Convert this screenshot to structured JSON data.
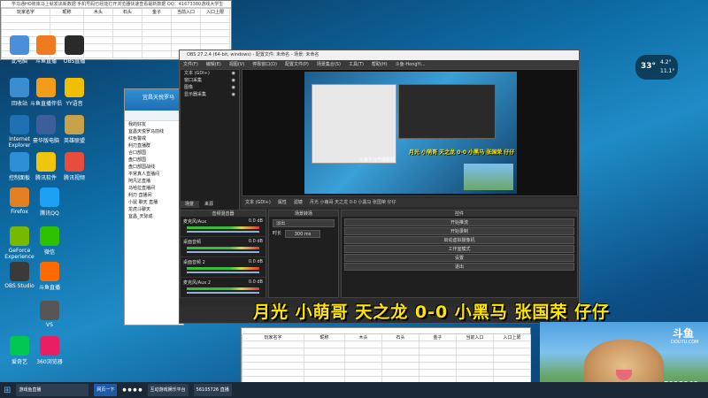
{
  "excel_top": {
    "title": "学马通HO账库马上就发出新数据 手机号码已经能打开浏览器快速查看最新数据 QQ：41673380游戏大学生",
    "headers": [
      "玩家名字",
      "昵称",
      "木头",
      "石头",
      "金子",
      "当前入口",
      "入口上限"
    ]
  },
  "desktop_icons": [
    {
      "label": "此电脑",
      "icon": "pc-icon"
    },
    {
      "label": "斗鱼直播",
      "icon": "douyu-icon"
    },
    {
      "label": "OBS直播",
      "icon": "obs-icon"
    },
    {
      "label": "回收站",
      "icon": "recycle-icon"
    },
    {
      "label": "斗鱼直播伴侣",
      "icon": "box-icon"
    },
    {
      "label": "YY语音",
      "icon": "yy-icon"
    },
    {
      "label": "Internet Explorer",
      "icon": "ie-icon"
    },
    {
      "label": "豪华版电脑",
      "icon": "app-icon"
    },
    {
      "label": "英雄联盟",
      "icon": "game-icon"
    },
    {
      "label": "控制面板",
      "icon": "control-icon"
    },
    {
      "label": "腾讯软件",
      "icon": "qq-app-icon"
    },
    {
      "label": "腾讯视频",
      "icon": "video-icon"
    },
    {
      "label": "Firefox",
      "icon": "firefox-icon"
    },
    {
      "label": "腾讯QQ",
      "icon": "qq-icon"
    },
    {
      "label": "GeForce Experience",
      "icon": "nvidia-icon"
    },
    {
      "label": "微信",
      "icon": "wechat-icon"
    },
    {
      "label": "OBS Studio",
      "icon": "obs-studio-icon"
    },
    {
      "label": "斗鱼直播",
      "icon": "douyu2-icon"
    },
    {
      "label": "VS",
      "icon": "vs-icon"
    },
    {
      "label": "爱奇艺",
      "icon": "iqiyi-icon"
    },
    {
      "label": "360浏览器",
      "icon": "browser360-icon"
    }
  ],
  "chat": {
    "title": "宜昌天悦罗马",
    "rows": [
      "我的好友",
      "宜昌天悦罗马前线",
      "红色警戒",
      "利刃直播群",
      "合口部国",
      "盘口部国",
      "盘口部国战线",
      "平常真人直播间",
      "阿凡达直播",
      "马哈拉直播间",
      "利刃 直播间",
      "小鼠 聊天 直播",
      "龙虎斗聊天",
      "宜昌_天际成"
    ]
  },
  "obs": {
    "title": "OBS 27.2.4 (64-bit, windows) - 配置文件: 未命名 - 场景: 未命名",
    "menu": [
      "文件(F)",
      "编辑(E)",
      "视图(V)",
      "停靠窗口(D)",
      "配置文件(P)",
      "场景集合(S)",
      "工具(T)",
      "帮助(H)",
      "斗鱼-HongYi..."
    ],
    "sources": [
      "文本 (GDI+)",
      "窗口采集",
      "图像",
      "显示器采集"
    ],
    "tabs": [
      "场景",
      "来源"
    ],
    "text_source": "文本 (GDI+)",
    "prop_btns": [
      "属性",
      "滤镜"
    ],
    "text_label": "月光 小萌哥 天之龙 0-0 小黑马 张国荣 仔仔",
    "mixer_label": "音频混音器",
    "mixer": [
      {
        "name": "麦克风/Aux",
        "db": "0.0 dB"
      },
      {
        "name": "桌面音频",
        "db": "0.0 dB"
      },
      {
        "name": "桌面音频 2",
        "db": "0.0 dB"
      },
      {
        "name": "麦克风/Aux 2",
        "db": "0.0 dB"
      }
    ],
    "transition_label": "场景转场",
    "transition_type": "淡出",
    "duration_label": "时长",
    "duration": "300 ms",
    "controls_label": "控件",
    "controls": [
      "开始推流",
      "开始录制",
      "启动虚拟摄像机",
      "工作室模式",
      "设置",
      "退出"
    ],
    "preview_subtitle": "斗鱼平台开播教程",
    "preview_banner": "月光 小萌哥 天之龙 0-0 小黑马 张国荣 仔仔"
  },
  "banner": "月光 小萌哥 天之龙 0-0 小黑马 张国荣 仔仔",
  "excel_bottom": {
    "headers": [
      "玩家名字",
      "昵称",
      "木头",
      "石头",
      "金子",
      "当前入口",
      "入口上限"
    ]
  },
  "dog_overlay": {
    "brand": "斗鱼",
    "domain": "DOUYU.COM",
    "room_id": "5913940"
  },
  "weather": {
    "value": "33°",
    "temp": "4.2°",
    "sub": "11.1°"
  },
  "taskbar": {
    "search": "游戏鱼直播",
    "browser": "网页一下",
    "items": [
      "互动游戏娱乐平台",
      "56105726 直播"
    ],
    "colors": {
      "bar": "#1b2838"
    }
  }
}
